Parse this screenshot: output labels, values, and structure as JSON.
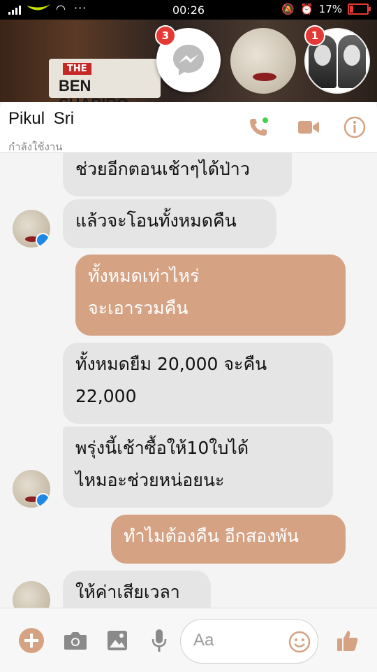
{
  "status_bar": {
    "time": "00:26",
    "battery": "17%"
  },
  "chat_heads": {
    "messenger_badge": "3",
    "contact_badge": "1",
    "video_brand_top": "THE",
    "video_brand_name": "BEN SHAPIRO"
  },
  "conversation": {
    "contact_name": "Pikul  Sri",
    "status": "กำลังใช้งาน"
  },
  "messages": [
    {
      "side": "in",
      "text": "ช่วยอีกตอนเช้าๆได้ป่าว"
    },
    {
      "side": "in",
      "text": "แล้วจะโอนทั้งหมดคืน"
    },
    {
      "side": "out",
      "line1": "ทั้งหมดเท่าไหร่",
      "line2": "จะเอารวมคืน"
    },
    {
      "side": "in",
      "line1": "ทั้งหมดยืม  20,000  จะคืน",
      "line2": "22,000"
    },
    {
      "side": "in",
      "line1": "พรุ่งนี้เช้าซื้อให้10ใบได้",
      "line2": "ไหมอะช่วยหน่อยนะ"
    },
    {
      "side": "out",
      "text": "ทำไมต้องคืน  อีกสองพัน"
    },
    {
      "side": "in",
      "text": "ให้ค่าเสียเวลา"
    }
  ],
  "composer": {
    "placeholder": "Aa"
  },
  "colors": {
    "accent": "#d5a284",
    "badge": "#e53935",
    "incoming_bubble": "#e5e5e5"
  },
  "icons": [
    "messenger-icon",
    "phone-icon",
    "video-call-icon",
    "info-icon",
    "plus-icon",
    "camera-icon",
    "gallery-icon",
    "microphone-icon",
    "emoji-icon",
    "thumbs-up-icon"
  ]
}
